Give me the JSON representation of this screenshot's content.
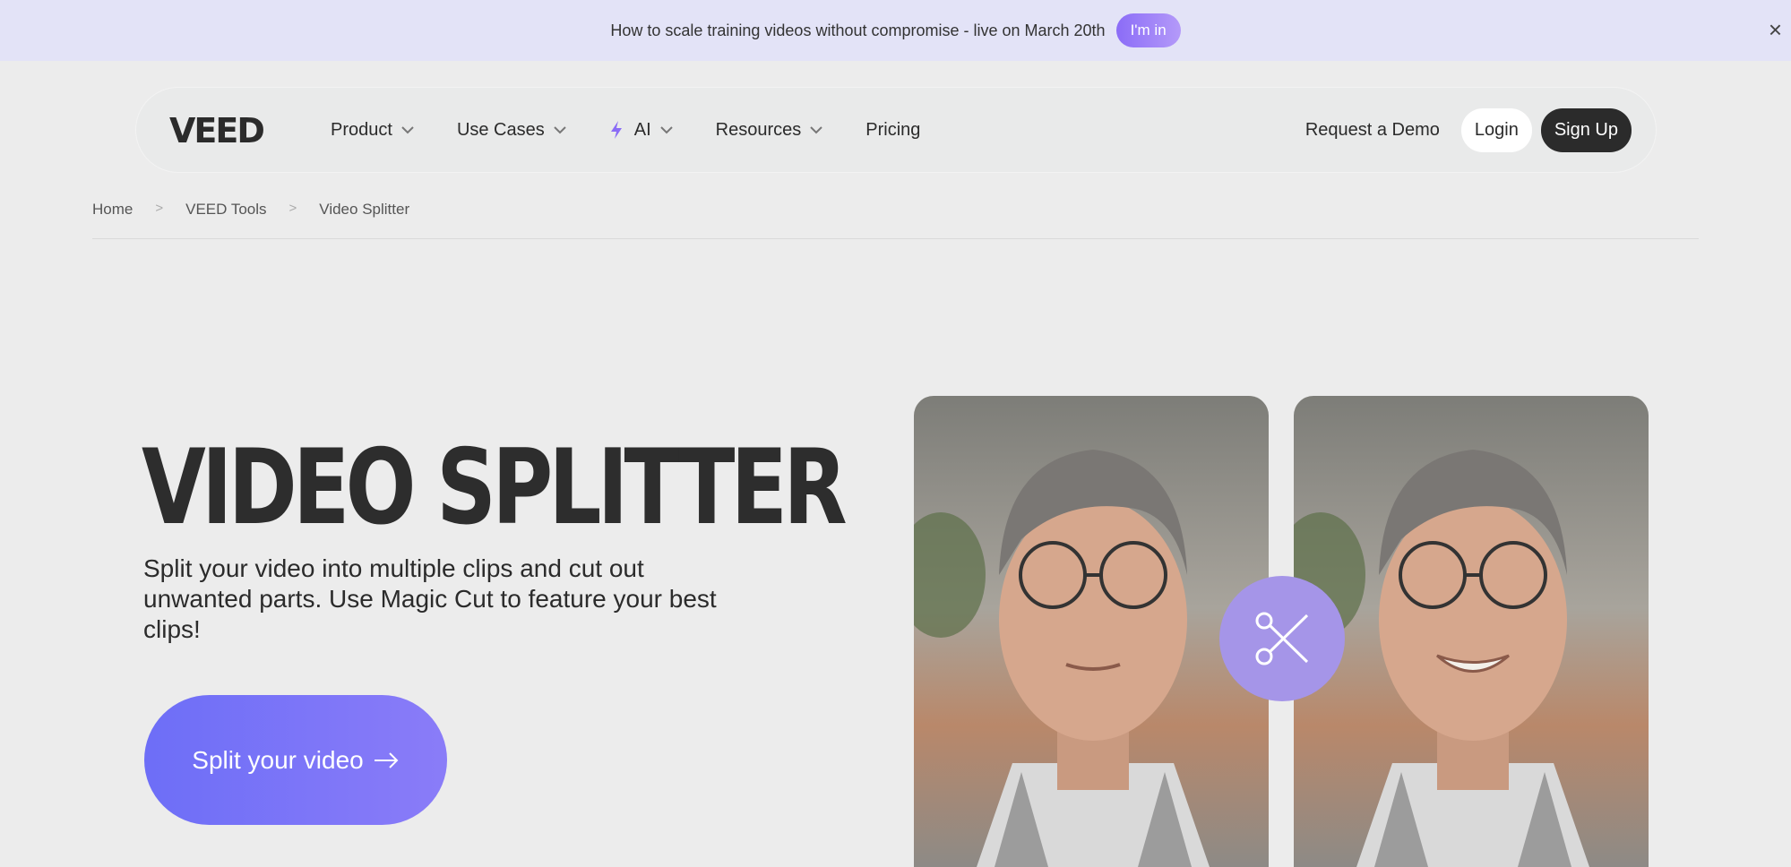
{
  "banner": {
    "text": "How to scale training videos without compromise - live on March 20th",
    "button_label": "I'm in",
    "close_label": "×"
  },
  "nav": {
    "logo_alt": "VEED",
    "items": [
      {
        "label": "Product",
        "has_dropdown": true
      },
      {
        "label": "Use Cases",
        "has_dropdown": true
      },
      {
        "label": "AI",
        "has_dropdown": true,
        "icon": "sparkle-icon"
      },
      {
        "label": "Resources",
        "has_dropdown": true
      },
      {
        "label": "Pricing",
        "has_dropdown": false
      }
    ],
    "demo_label": "Request a Demo",
    "login_label": "Login",
    "signup_label": "Sign Up"
  },
  "breadcrumb": {
    "items": [
      "Home",
      "VEED Tools",
      "Video Splitter"
    ],
    "separator": ">"
  },
  "hero": {
    "title": "VIDEO SPLITTER",
    "subtitle": "Split your video into multiple clips and cut out unwanted parts. Use Magic Cut to feature your best clips!",
    "cta_label": "Split your video"
  },
  "colors": {
    "accent": "#7b72f7",
    "banner_bg": "#e3e3f7",
    "page_bg": "#ececec"
  }
}
